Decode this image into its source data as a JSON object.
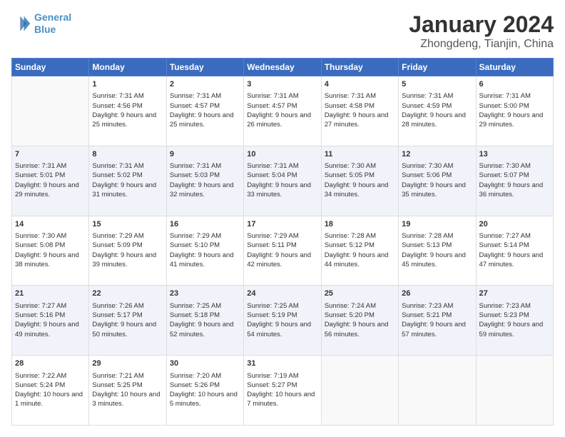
{
  "header": {
    "logo_line1": "General",
    "logo_line2": "Blue",
    "title": "January 2024",
    "subtitle": "Zhongdeng, Tianjin, China"
  },
  "days_of_week": [
    "Sunday",
    "Monday",
    "Tuesday",
    "Wednesday",
    "Thursday",
    "Friday",
    "Saturday"
  ],
  "weeks": [
    [
      {
        "day": "",
        "sunrise": "",
        "sunset": "",
        "daylight": ""
      },
      {
        "day": "1",
        "sunrise": "Sunrise: 7:31 AM",
        "sunset": "Sunset: 4:56 PM",
        "daylight": "Daylight: 9 hours and 25 minutes."
      },
      {
        "day": "2",
        "sunrise": "Sunrise: 7:31 AM",
        "sunset": "Sunset: 4:57 PM",
        "daylight": "Daylight: 9 hours and 25 minutes."
      },
      {
        "day": "3",
        "sunrise": "Sunrise: 7:31 AM",
        "sunset": "Sunset: 4:57 PM",
        "daylight": "Daylight: 9 hours and 26 minutes."
      },
      {
        "day": "4",
        "sunrise": "Sunrise: 7:31 AM",
        "sunset": "Sunset: 4:58 PM",
        "daylight": "Daylight: 9 hours and 27 minutes."
      },
      {
        "day": "5",
        "sunrise": "Sunrise: 7:31 AM",
        "sunset": "Sunset: 4:59 PM",
        "daylight": "Daylight: 9 hours and 28 minutes."
      },
      {
        "day": "6",
        "sunrise": "Sunrise: 7:31 AM",
        "sunset": "Sunset: 5:00 PM",
        "daylight": "Daylight: 9 hours and 29 minutes."
      }
    ],
    [
      {
        "day": "7",
        "sunrise": "Sunrise: 7:31 AM",
        "sunset": "Sunset: 5:01 PM",
        "daylight": "Daylight: 9 hours and 29 minutes."
      },
      {
        "day": "8",
        "sunrise": "Sunrise: 7:31 AM",
        "sunset": "Sunset: 5:02 PM",
        "daylight": "Daylight: 9 hours and 31 minutes."
      },
      {
        "day": "9",
        "sunrise": "Sunrise: 7:31 AM",
        "sunset": "Sunset: 5:03 PM",
        "daylight": "Daylight: 9 hours and 32 minutes."
      },
      {
        "day": "10",
        "sunrise": "Sunrise: 7:31 AM",
        "sunset": "Sunset: 5:04 PM",
        "daylight": "Daylight: 9 hours and 33 minutes."
      },
      {
        "day": "11",
        "sunrise": "Sunrise: 7:30 AM",
        "sunset": "Sunset: 5:05 PM",
        "daylight": "Daylight: 9 hours and 34 minutes."
      },
      {
        "day": "12",
        "sunrise": "Sunrise: 7:30 AM",
        "sunset": "Sunset: 5:06 PM",
        "daylight": "Daylight: 9 hours and 35 minutes."
      },
      {
        "day": "13",
        "sunrise": "Sunrise: 7:30 AM",
        "sunset": "Sunset: 5:07 PM",
        "daylight": "Daylight: 9 hours and 36 minutes."
      }
    ],
    [
      {
        "day": "14",
        "sunrise": "Sunrise: 7:30 AM",
        "sunset": "Sunset: 5:08 PM",
        "daylight": "Daylight: 9 hours and 38 minutes."
      },
      {
        "day": "15",
        "sunrise": "Sunrise: 7:29 AM",
        "sunset": "Sunset: 5:09 PM",
        "daylight": "Daylight: 9 hours and 39 minutes."
      },
      {
        "day": "16",
        "sunrise": "Sunrise: 7:29 AM",
        "sunset": "Sunset: 5:10 PM",
        "daylight": "Daylight: 9 hours and 41 minutes."
      },
      {
        "day": "17",
        "sunrise": "Sunrise: 7:29 AM",
        "sunset": "Sunset: 5:11 PM",
        "daylight": "Daylight: 9 hours and 42 minutes."
      },
      {
        "day": "18",
        "sunrise": "Sunrise: 7:28 AM",
        "sunset": "Sunset: 5:12 PM",
        "daylight": "Daylight: 9 hours and 44 minutes."
      },
      {
        "day": "19",
        "sunrise": "Sunrise: 7:28 AM",
        "sunset": "Sunset: 5:13 PM",
        "daylight": "Daylight: 9 hours and 45 minutes."
      },
      {
        "day": "20",
        "sunrise": "Sunrise: 7:27 AM",
        "sunset": "Sunset: 5:14 PM",
        "daylight": "Daylight: 9 hours and 47 minutes."
      }
    ],
    [
      {
        "day": "21",
        "sunrise": "Sunrise: 7:27 AM",
        "sunset": "Sunset: 5:16 PM",
        "daylight": "Daylight: 9 hours and 49 minutes."
      },
      {
        "day": "22",
        "sunrise": "Sunrise: 7:26 AM",
        "sunset": "Sunset: 5:17 PM",
        "daylight": "Daylight: 9 hours and 50 minutes."
      },
      {
        "day": "23",
        "sunrise": "Sunrise: 7:25 AM",
        "sunset": "Sunset: 5:18 PM",
        "daylight": "Daylight: 9 hours and 52 minutes."
      },
      {
        "day": "24",
        "sunrise": "Sunrise: 7:25 AM",
        "sunset": "Sunset: 5:19 PM",
        "daylight": "Daylight: 9 hours and 54 minutes."
      },
      {
        "day": "25",
        "sunrise": "Sunrise: 7:24 AM",
        "sunset": "Sunset: 5:20 PM",
        "daylight": "Daylight: 9 hours and 56 minutes."
      },
      {
        "day": "26",
        "sunrise": "Sunrise: 7:23 AM",
        "sunset": "Sunset: 5:21 PM",
        "daylight": "Daylight: 9 hours and 57 minutes."
      },
      {
        "day": "27",
        "sunrise": "Sunrise: 7:23 AM",
        "sunset": "Sunset: 5:23 PM",
        "daylight": "Daylight: 9 hours and 59 minutes."
      }
    ],
    [
      {
        "day": "28",
        "sunrise": "Sunrise: 7:22 AM",
        "sunset": "Sunset: 5:24 PM",
        "daylight": "Daylight: 10 hours and 1 minute."
      },
      {
        "day": "29",
        "sunrise": "Sunrise: 7:21 AM",
        "sunset": "Sunset: 5:25 PM",
        "daylight": "Daylight: 10 hours and 3 minutes."
      },
      {
        "day": "30",
        "sunrise": "Sunrise: 7:20 AM",
        "sunset": "Sunset: 5:26 PM",
        "daylight": "Daylight: 10 hours and 5 minutes."
      },
      {
        "day": "31",
        "sunrise": "Sunrise: 7:19 AM",
        "sunset": "Sunset: 5:27 PM",
        "daylight": "Daylight: 10 hours and 7 minutes."
      },
      {
        "day": "",
        "sunrise": "",
        "sunset": "",
        "daylight": ""
      },
      {
        "day": "",
        "sunrise": "",
        "sunset": "",
        "daylight": ""
      },
      {
        "day": "",
        "sunrise": "",
        "sunset": "",
        "daylight": ""
      }
    ]
  ]
}
